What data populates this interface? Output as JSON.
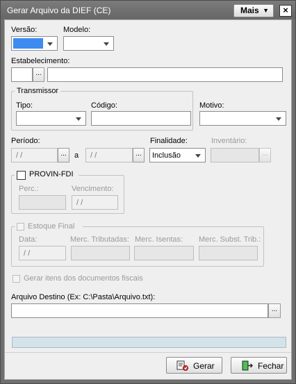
{
  "window": {
    "title": "Gerar Arquivo da DIEF (CE)",
    "mais_label": "Mais",
    "close_label": "×"
  },
  "form": {
    "versao_label": "Versão:",
    "modelo_label": "Modelo:",
    "estabelecimento_label": "Estabelecimento:",
    "ellipsis": "...",
    "transmissor": {
      "title": "Transmissor",
      "tipo_label": "Tipo:",
      "codigo_label": "Código:"
    },
    "motivo_label": "Motivo:",
    "periodo_label": "Período:",
    "periodo_inicio": " /  /",
    "a_label": "a",
    "periodo_fim": " /  /",
    "finalidade_label": "Finalidade:",
    "finalidade_value": "Inclusão",
    "inventario_label": "Inventário:",
    "provin": {
      "title": "PROVIN-FDI",
      "perc_label": "Perc.:",
      "vencimento_label": "Vencimento:",
      "vencimento_value": " /  /"
    },
    "estoque": {
      "title": "Estoque Final",
      "data_label": "Data:",
      "data_value": " /  /",
      "tributadas_label": "Merc. Tributadas:",
      "isentas_label": "Merc. Isentas:",
      "subst_label": "Merc. Subst. Trib.:"
    },
    "gerar_itens_label": "Gerar itens dos documentos fiscais",
    "arquivo_label": "Arquivo Destino (Ex: C:\\Pasta\\Arquivo.txt):"
  },
  "buttons": {
    "gerar_label": "Gerar",
    "fechar_label": "Fechar"
  },
  "colors": {
    "versao_selected": "#3d8bf0",
    "progress_bg": "#d4e2ea"
  }
}
